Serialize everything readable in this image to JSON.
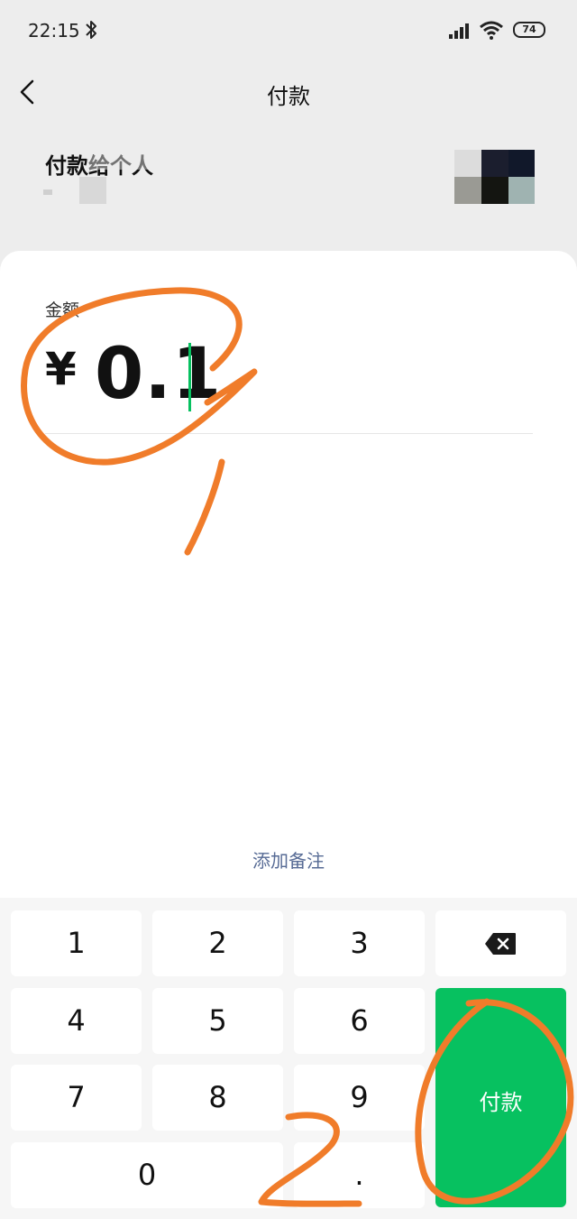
{
  "status_bar": {
    "time": "22:15",
    "battery_level": "74",
    "icons": [
      "bluetooth-icon",
      "signal-icon",
      "wifi-icon",
      "battery-icon"
    ]
  },
  "nav": {
    "title": "付款",
    "back_icon": "chevron-left-icon"
  },
  "payee": {
    "title": "付款给个人"
  },
  "amount": {
    "label": "金额",
    "currency_symbol": "¥",
    "value": "0.1"
  },
  "add_note": "添加备注",
  "keypad": {
    "keys": [
      "1",
      "2",
      "3",
      "4",
      "5",
      "6",
      "7",
      "8",
      "9",
      "0",
      "."
    ],
    "delete_icon": "backspace-icon",
    "pay_label": "付款"
  },
  "annotations": {
    "marks": [
      "1",
      "2"
    ],
    "color": "#f07c2a"
  },
  "colors": {
    "accent": "#07c160",
    "link": "#576b95",
    "background": "#ededed"
  }
}
